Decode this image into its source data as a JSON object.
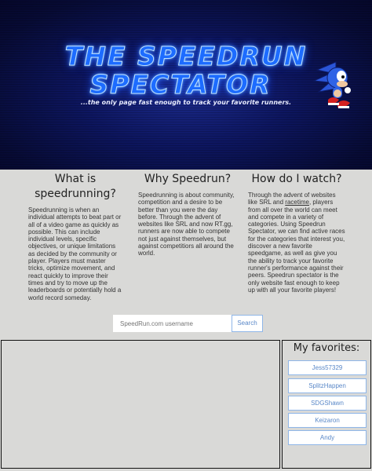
{
  "banner": {
    "title_line1": "THE SPEEDRUN",
    "title_line2": "SPECTATOR",
    "tagline": "...the only page fast enough to track your favorite runners."
  },
  "sections": [
    {
      "heading": "What is speedrunning?",
      "body": "Speedrunning is when an individual attempts to beat part or all of a video game as quickly as possible. This can include individual levels, specific objectives, or unique limitations as decided by the community or player. Players must master tricks, optimize movement, and react quickly to improve their times and try to move up the leaderboards or potentially hold a world record someday."
    },
    {
      "heading": "Why Speedrun?",
      "body": "Speedrunning is about community, competition and a desire to be better than you were the day before. Through the advent of websites like SRL and now RT.gg, runners are now able to compete not just against themselves, but against competitiors all around the world."
    },
    {
      "heading": "How do I watch?",
      "body_pre": "Through the advent of websites like SRL and ",
      "link": "racetime",
      "body_post": ", players from all over the world can meet and compete in a variety of categories. Using Speedrun Spectator, we can find active races for the categories that interest you, discover a new favorite speedgame, as well as give you the ability to track your favorite runner's performance against their peers. Speedrun spectator is the only website fast enough to keep up with all your favorite players!"
    }
  ],
  "search": {
    "placeholder": "SpeedRun.com username",
    "button": "Search"
  },
  "favorites": {
    "title": "My favorites:",
    "items": [
      "Jess57329",
      "SplitzHappen",
      "SDGShawn",
      "Keizaron",
      "Andy"
    ]
  },
  "colors": {
    "accent": "#5a88c8",
    "banner_bg": "#0d1660",
    "title_glow": "#1d6cff",
    "page_bg": "#d9d9d7"
  }
}
